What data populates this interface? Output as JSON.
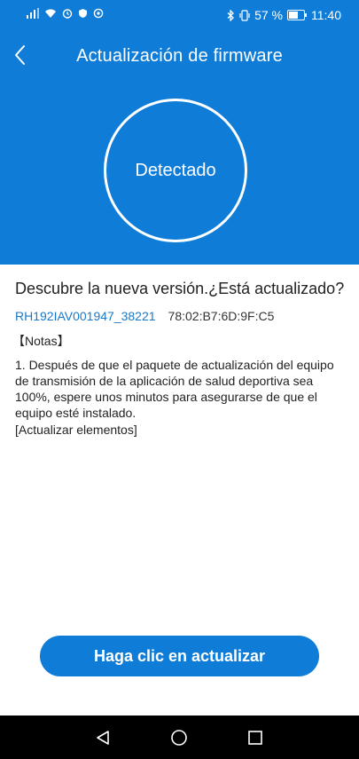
{
  "status_bar": {
    "battery_percent": "57 %",
    "time": "11:40",
    "icons": [
      "signal-icon",
      "wifi-icon",
      "alarm-icon",
      "notification-icon",
      "app-notification-icon",
      "bluetooth-icon",
      "vibrate-icon",
      "battery-icon"
    ]
  },
  "header": {
    "title": "Actualización de firmware",
    "back_icon": "chevron-left-icon"
  },
  "status_circle": {
    "label": "Detectado"
  },
  "content": {
    "heading": "Descubre la nueva versión.¿Está actualizado?",
    "device_id": "RH192IAV001947_38221",
    "mac_address": "78:02:B7:6D:9F:C5",
    "notes_title": "【Notas】",
    "notes_text": "1. Después de que el paquete de actualización del equipo de transmisión de la aplicación de salud deportiva sea 100%, espere unos minutos para asegurarse de que el equipo esté instalado.",
    "update_items": "[Actualizar elementos]"
  },
  "update_button": {
    "label": "Haga clic en actualizar"
  },
  "nav_bar": {
    "icons": [
      "back-triangle-icon",
      "home-circle-icon",
      "recents-square-icon"
    ]
  },
  "colors": {
    "primary": "#0f7dd8",
    "link": "#1a78c8",
    "nav_bg": "#000000"
  }
}
